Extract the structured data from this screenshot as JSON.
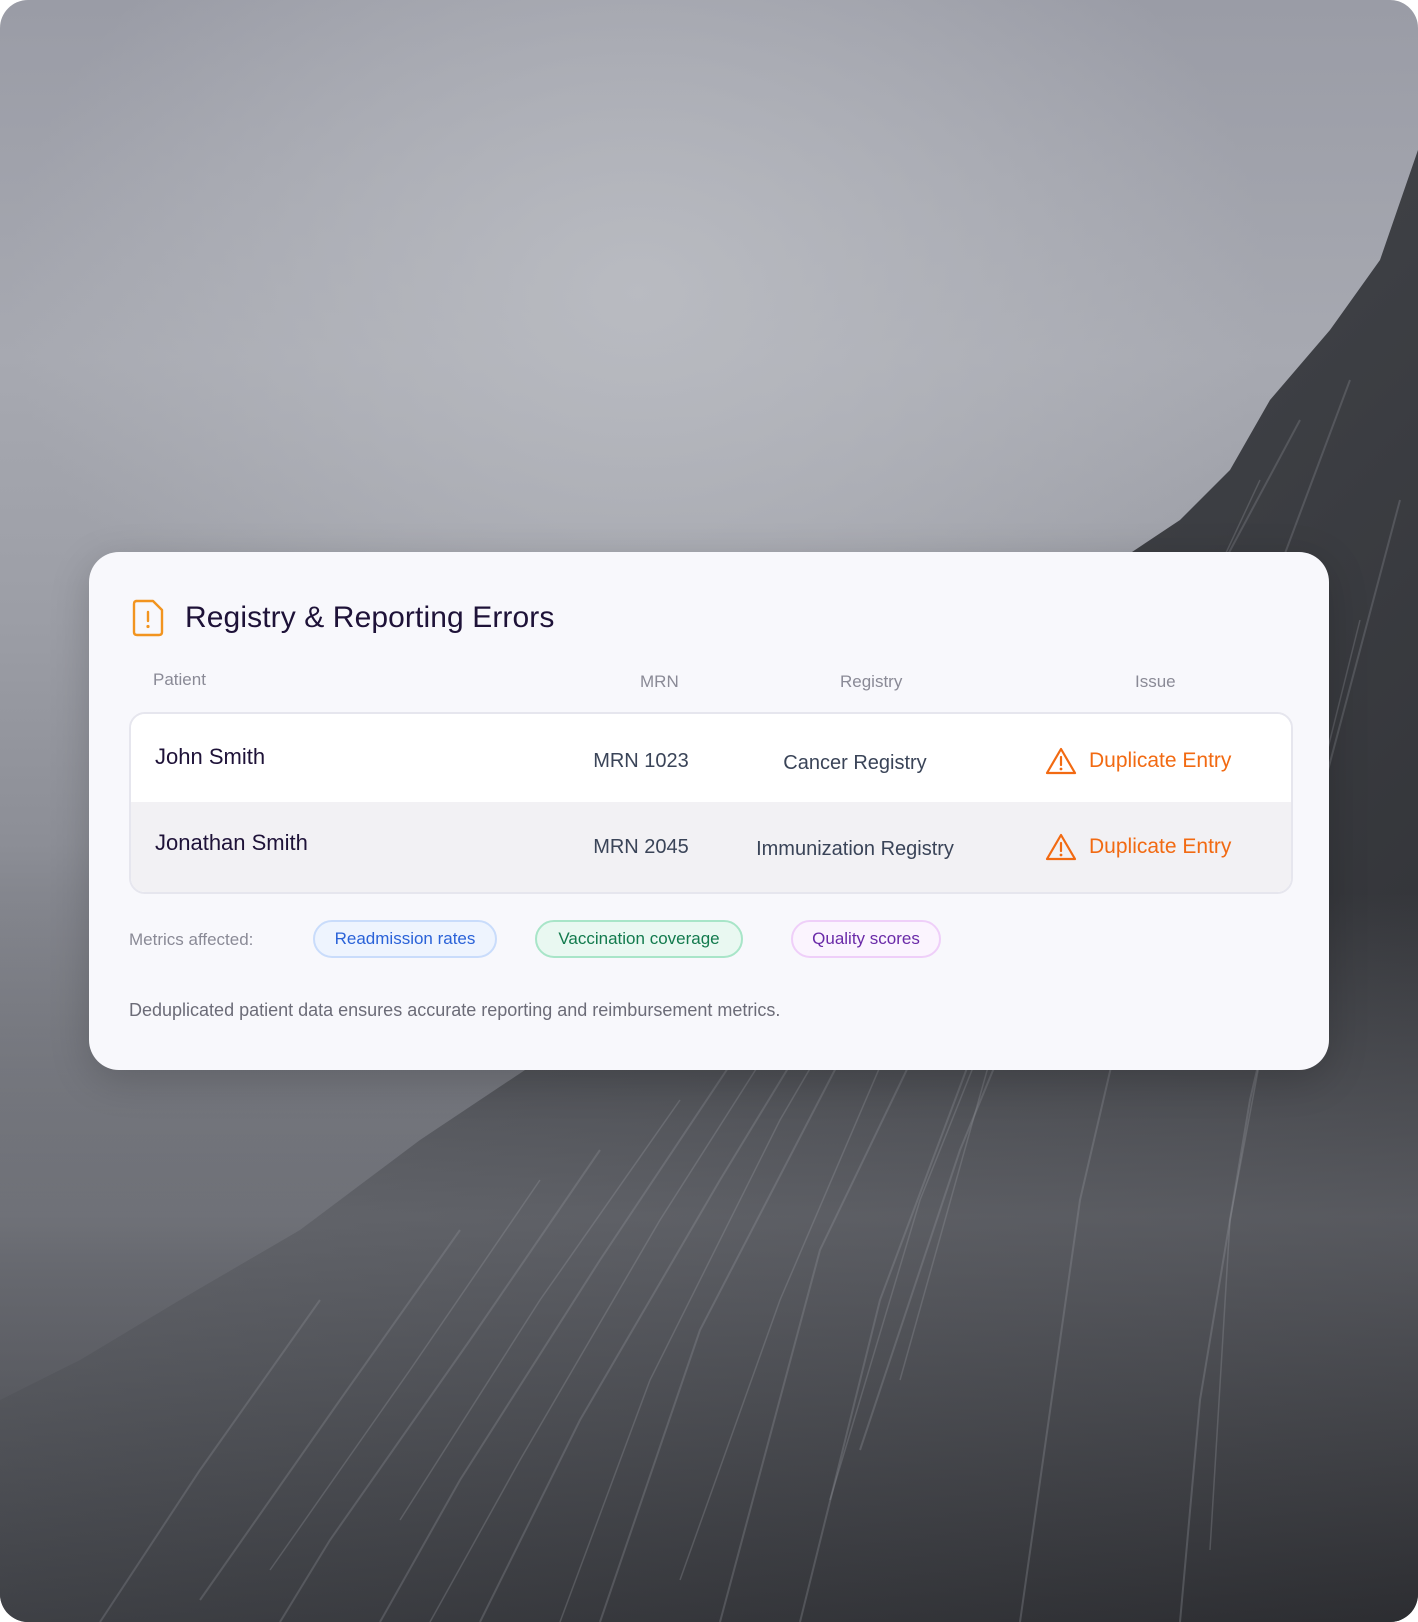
{
  "card": {
    "title": "Registry & Reporting Errors",
    "icon": "document-alert-icon",
    "columns": {
      "patient": "Patient",
      "mrn": "MRN",
      "registry": "Registry",
      "issue": "Issue"
    },
    "rows": [
      {
        "patient": "John Smith",
        "mrn": "MRN 1023",
        "registry": "Cancer Registry",
        "issue": "Duplicate Entry",
        "issue_icon": "warning-triangle-icon"
      },
      {
        "patient": "Jonathan Smith",
        "mrn": "MRN 2045",
        "registry": "Immunization Registry",
        "issue": "Duplicate Entry",
        "issue_icon": "warning-triangle-icon"
      }
    ],
    "metrics_label": "Metrics affected:",
    "metrics": [
      {
        "label": "Readmission rates",
        "color": "#2a62d8"
      },
      {
        "label": "Vaccination coverage",
        "color": "#127a4d"
      },
      {
        "label": "Quality scores",
        "color": "#6a2aa8"
      }
    ],
    "footer": "Deduplicated patient data ensures accurate reporting and reimbursement metrics.",
    "colors": {
      "accent_warning": "#f26a12",
      "title": "#1e1238"
    }
  }
}
